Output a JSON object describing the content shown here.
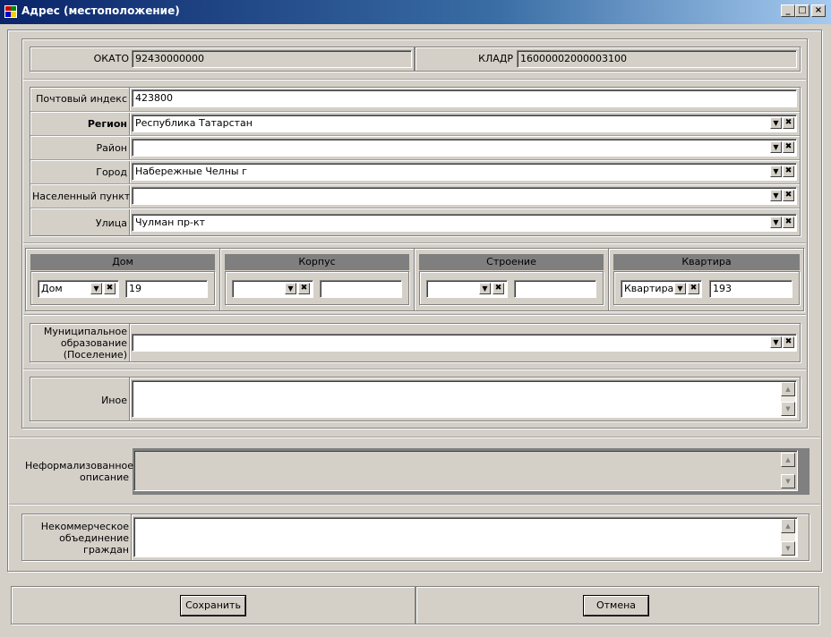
{
  "window": {
    "title": "Адрес (местоположение)"
  },
  "codes": {
    "okato_label": "ОКАТО",
    "okato_value": "92430000000",
    "kladr_label": "КЛАДР",
    "kladr_value": "16000002000003100"
  },
  "address": {
    "postal_label": "Почтовый индекс",
    "postal_value": "423800",
    "region_label": "Регион",
    "region_value": "Республика Татарстан",
    "district_label": "Район",
    "district_value": "",
    "city_label": "Город",
    "city_value": "Набережные Челны г",
    "locality_label": "Населенный пункт",
    "locality_value": "",
    "street_label": "Улица",
    "street_value": "Чулман пр-кт"
  },
  "building": {
    "house": {
      "header": "Дом",
      "type": "Дом",
      "value": "19"
    },
    "korpus": {
      "header": "Корпус",
      "type": "",
      "value": ""
    },
    "stroenie": {
      "header": "Строение",
      "type": "",
      "value": ""
    },
    "apartment": {
      "header": "Квартира",
      "type": "Квартира",
      "value": "193"
    }
  },
  "municipal": {
    "label_line1": "Муниципальное",
    "label_line2": "образование",
    "label_line3": "(Поселение)",
    "value": ""
  },
  "other": {
    "label": "Иное",
    "value": ""
  },
  "informal": {
    "label_line1": "Неформализованное",
    "label_line2": "описание",
    "value": ""
  },
  "noncommercial": {
    "label_line1": "Некоммерческое",
    "label_line2": "объединение",
    "label_line3": "граждан",
    "value": ""
  },
  "buttons": {
    "save": "Сохранить",
    "cancel": "Отмена"
  },
  "icons": {
    "dropdown": "▼",
    "clear": "✖",
    "scroll_up": "▲",
    "scroll_down": "▼",
    "minimize": "_",
    "maximize": "□",
    "close": "×"
  }
}
